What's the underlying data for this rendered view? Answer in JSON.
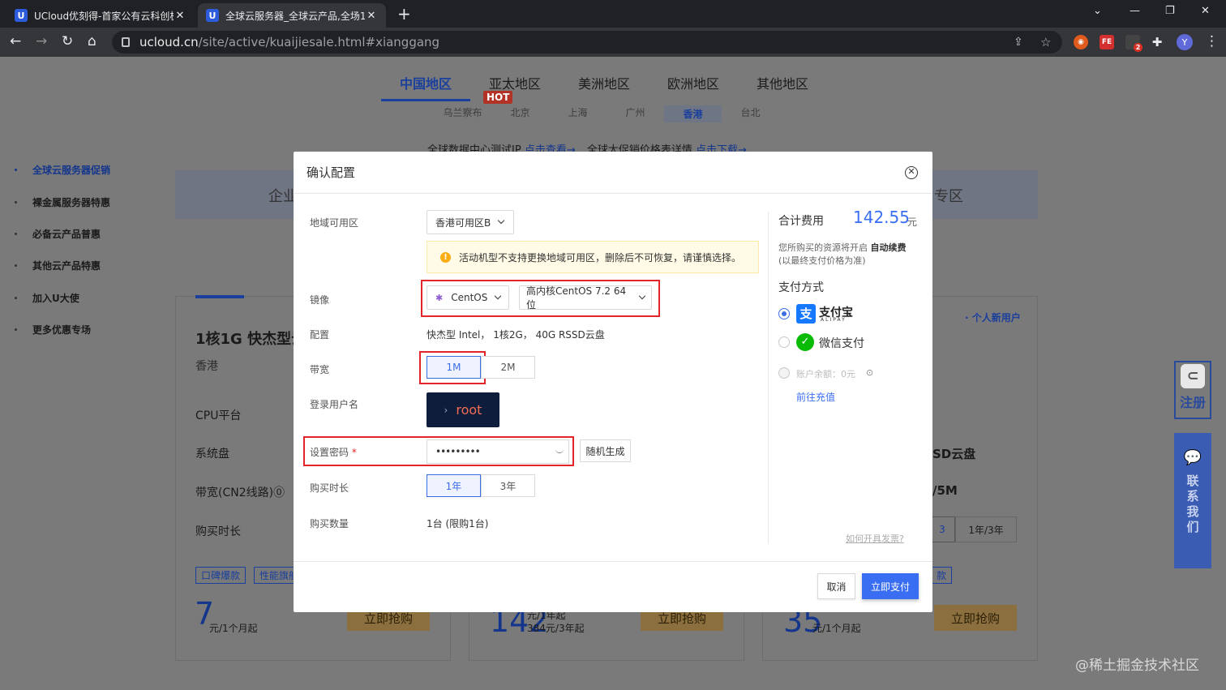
{
  "browser": {
    "tabs": [
      {
        "title": "UCloud优刻得-首家公有云科创板",
        "favicon": "U"
      },
      {
        "title": "全球云服务器_全球云产品,全场1折",
        "favicon": "U"
      }
    ],
    "url_domain": "ucloud.cn",
    "url_path": "/site/active/kuaijiesale.html#xianggang",
    "profile_initial": "Y",
    "ext_badge": "2"
  },
  "page": {
    "region_tabs": [
      "中国地区",
      "亚太地区",
      "美洲地区",
      "欧洲地区",
      "其他地区"
    ],
    "hot_badge": "HOT",
    "cities": [
      "乌兰察布",
      "北京",
      "上海",
      "广州",
      "香港",
      "台北"
    ],
    "notice_text1": "全球数据中心测试IP",
    "notice_link1": "点击查看→",
    "notice_text2": "全球大促销价格表详情",
    "notice_link2": "点击下载→",
    "sidebar": [
      "全球云服务器促销",
      "裸金属服务器特惠",
      "必备云产品普惠",
      "其他云产品特惠",
      "加入U大使",
      "更多优惠专场"
    ],
    "bg_left_partial": "企业",
    "bg_right_partial": "专区",
    "bg_card_title": "1核1G 快杰型云",
    "bg_card_region": "香港",
    "bg_rows": [
      "CPU平台",
      "系统盘",
      "带宽(CN2线路)⓪",
      "购买时长"
    ],
    "bg_tags": [
      "口碑爆款",
      "性能旗舰"
    ],
    "bg_right_tag": "个人新用户",
    "bg_right_ssd": "SD云盘",
    "bg_right_bw": "/5M",
    "bg_right_period": "1年/3年",
    "bg_right_period_partial": "3",
    "bg_right_tag2": "款",
    "price_cards": [
      {
        "big": "7",
        "sub": "元/1个月起"
      },
      {
        "big": "142",
        "sub1": "元/1年起",
        "sub2": "384元/3年起"
      },
      {
        "big": "35",
        "sub": "元/1个月起"
      }
    ],
    "buy_label": "立即抢购",
    "float_register": "注册",
    "float_contact": "联系我们",
    "watermark": "@稀土掘金技术社区"
  },
  "modal": {
    "title": "确认配置",
    "labels": {
      "zone": "地域可用区",
      "image": "镜像",
      "config": "配置",
      "bandwidth": "带宽",
      "login_user": "登录用户名",
      "password": "设置密码",
      "required_mark": "*",
      "duration": "购买时长",
      "quantity": "购买数量"
    },
    "zone_value": "香港可用区B",
    "warning": "活动机型不支持更换地域可用区，删除后不可恢复，请谨慎选择。",
    "os_value": "CentOS",
    "os_version": "高内核CentOS 7.2 64位",
    "config_value": "快杰型 Intel，  1核2G，  40G RSSD云盘",
    "bandwidth_options": [
      "1M",
      "2M"
    ],
    "login_user": "root",
    "password_masked": "•••••••••",
    "random_btn": "随机生成",
    "duration_options": [
      "1年",
      "3年"
    ],
    "quantity_value": "1台  (限购1台)",
    "total_label": "合计费用",
    "total_value": "142.55",
    "total_unit": "元",
    "auto_renew_note1": "您所购买的资源将开启",
    "auto_renew_bold": "自动续费",
    "auto_renew_note2": "(以最终支付价格为准)",
    "pay_method_label": "支付方式",
    "alipay_label": "支付宝",
    "alipay_sub": "ALIPAY",
    "wechat_label": "微信支付",
    "balance_label": "账户余额：0元",
    "recharge_link": "前往充值",
    "invoice_link": "如何开具发票?",
    "cancel_btn": "取消",
    "pay_btn": "立即支付",
    "colors": {
      "primary": "#3a6ef2",
      "highlight": "#e3242b",
      "warn": "#faad14",
      "wechat": "#09bb07",
      "alipay": "#1677ff"
    }
  }
}
